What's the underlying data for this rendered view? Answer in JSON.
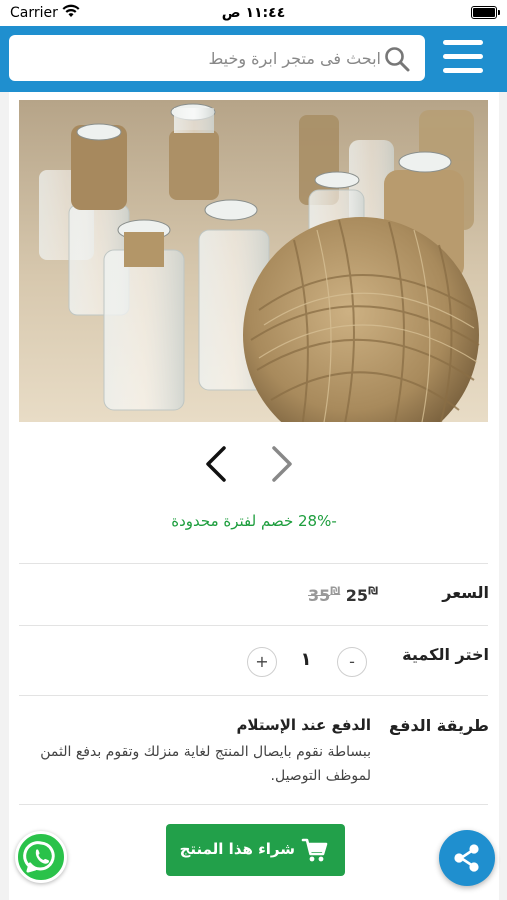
{
  "status_bar": {
    "carrier": "Carrier",
    "time": "١١:٤٤ ص"
  },
  "header": {
    "search_placeholder": "ابحث فى متجر ابرة وخيط"
  },
  "product": {
    "discount_text": "-28% خصم لفترة محدودة",
    "price_label": "السعر",
    "current_price": "25",
    "old_price": "35",
    "currency_symbol": "₪",
    "quantity_label": "اختر الكمية",
    "quantity_value": "١",
    "qty_minus": "-",
    "qty_plus": "+",
    "payment_label": "طريقة الدفع",
    "payment_title": "الدفع عند الإستلام",
    "payment_description": "ببساطة نقوم بايصال المنتج لغاية منزلك وتقوم بدفع الثمن لموظف التوصيل."
  },
  "buy_button": {
    "label": "شراء هذا المنتج"
  },
  "icons": {
    "menu": "hamburger-icon",
    "search": "search-icon",
    "cart": "cart-icon",
    "share": "share-icon",
    "whatsapp": "whatsapp-icon"
  },
  "colors": {
    "primary": "#1f8fcf",
    "accent_green": "#22a04a",
    "discount_green": "#1e9e3e"
  }
}
